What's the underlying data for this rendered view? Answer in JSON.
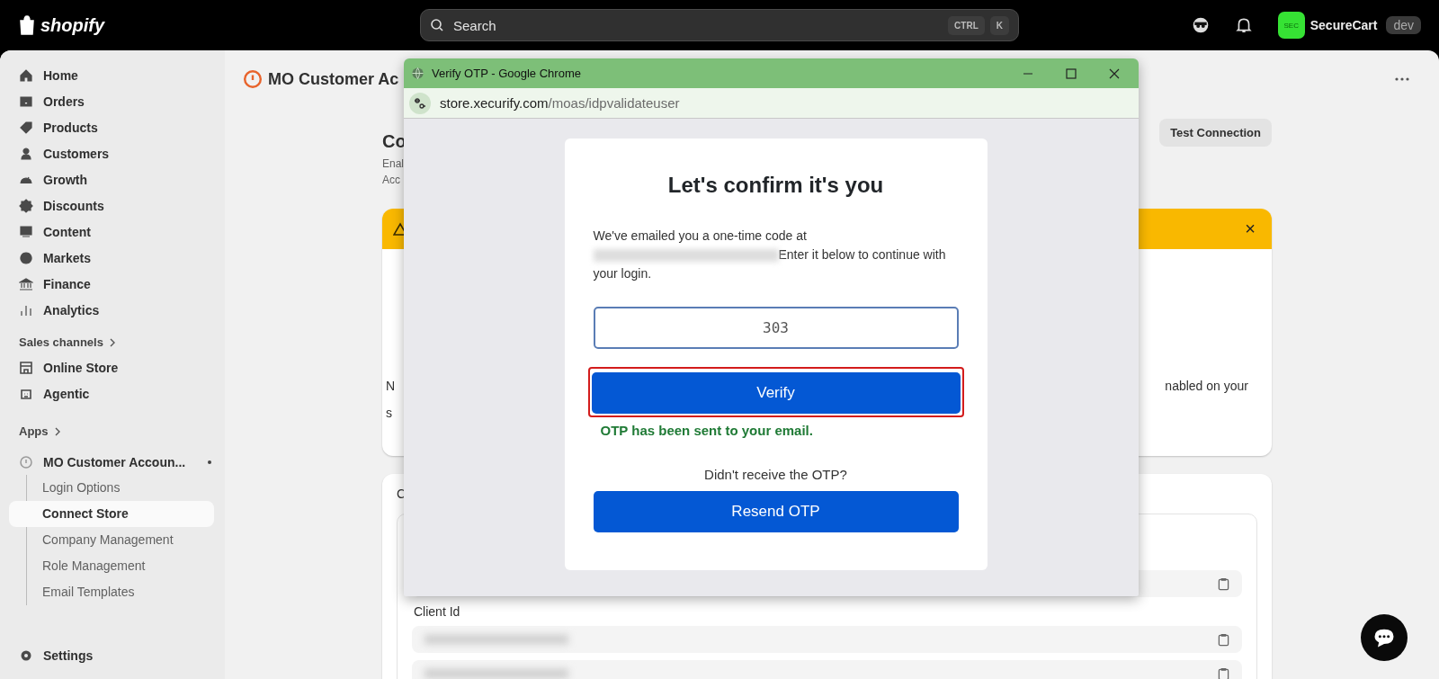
{
  "topbar": {
    "logo": "shopify",
    "search": {
      "placeholder": "Search",
      "keys": [
        "CTRL",
        "K"
      ]
    },
    "store": {
      "badge": "SEC",
      "name": "SecureCart",
      "tag": "dev"
    }
  },
  "sidebar": {
    "items": [
      {
        "label": "Home"
      },
      {
        "label": "Orders"
      },
      {
        "label": "Products"
      },
      {
        "label": "Customers"
      },
      {
        "label": "Growth"
      },
      {
        "label": "Discounts"
      },
      {
        "label": "Content"
      },
      {
        "label": "Markets"
      },
      {
        "label": "Finance"
      },
      {
        "label": "Analytics"
      }
    ],
    "sales_channels": {
      "label": "Sales channels",
      "items": [
        {
          "label": "Online Store"
        },
        {
          "label": "Agentic"
        }
      ]
    },
    "apps": {
      "label": "Apps",
      "app": {
        "label": "MO Customer Accoun...",
        "children": [
          {
            "label": "Login Options",
            "selected": false
          },
          {
            "label": "Connect Store",
            "selected": true
          },
          {
            "label": "Company Management",
            "selected": false
          },
          {
            "label": "Role Management",
            "selected": false
          },
          {
            "label": "Email Templates",
            "selected": false
          }
        ]
      }
    },
    "footer_item": {
      "label": "Settings"
    }
  },
  "main": {
    "app_title": "MO Customer Ac",
    "heading": "Co",
    "description": [
      "Enal",
      "Acc"
    ],
    "test_button": "Test Connection",
    "banner": {
      "close": "×"
    },
    "notice": {
      "left": [
        "N",
        "s"
      ],
      "right": "nabled on your"
    },
    "section": {
      "title": "C",
      "field_label": "Client Id"
    }
  },
  "popup": {
    "title": "Verify OTP - Google Chrome",
    "url_host": "store.xecurify.com",
    "url_path": "/moas/idpvalidateuser",
    "heading": "Let's confirm it's you",
    "message_start": "We've emailed you a one-time code at",
    "message_end": "Enter it below to continue with your login.",
    "otp_value": "303",
    "verify": "Verify",
    "status": "OTP has been sent to your email.",
    "resend_prompt": "Didn't receive the OTP?",
    "resend": "Resend OTP"
  }
}
